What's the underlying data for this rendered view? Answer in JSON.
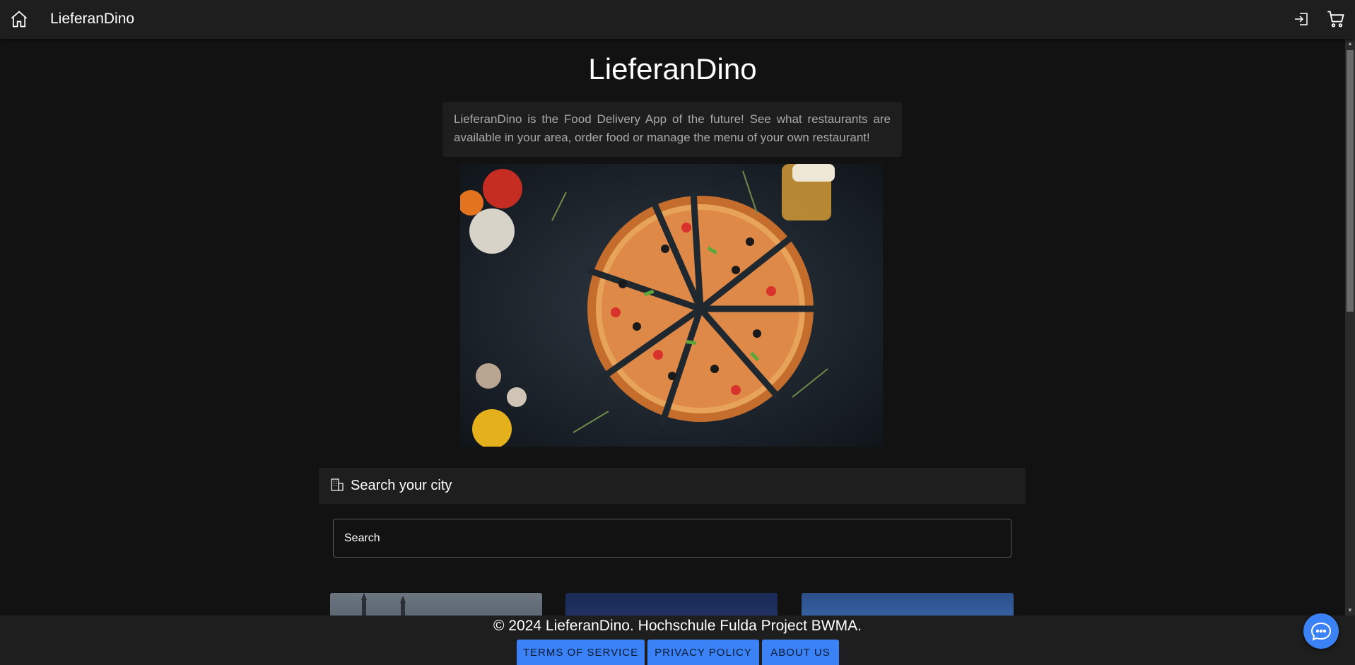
{
  "header": {
    "brand": "LieferanDino",
    "home_icon": "home-icon",
    "login_icon": "login-icon",
    "cart_icon": "cart-icon"
  },
  "main": {
    "title": "LieferanDino",
    "intro": "LieferanDino is the Food Delivery App of the future! See what restaurants are available in your area, order food or manage the menu of your own restaurant!",
    "search_section_title": "Search your city",
    "search_icon": "building-icon",
    "search_placeholder": "Search"
  },
  "footer": {
    "copyright": "© 2024 LieferanDino. Hochschule Fulda Project BWMA.",
    "buttons": [
      "TERMS OF SERVICE",
      "PRIVACY POLICY",
      "ABOUT US"
    ]
  },
  "chat": {
    "icon": "chat-icon"
  },
  "colors": {
    "background": "#121212",
    "surface": "#1e1e1e",
    "accent": "#3b82f6",
    "text": "#ffffff",
    "muted_text": "#a9a9a9"
  }
}
